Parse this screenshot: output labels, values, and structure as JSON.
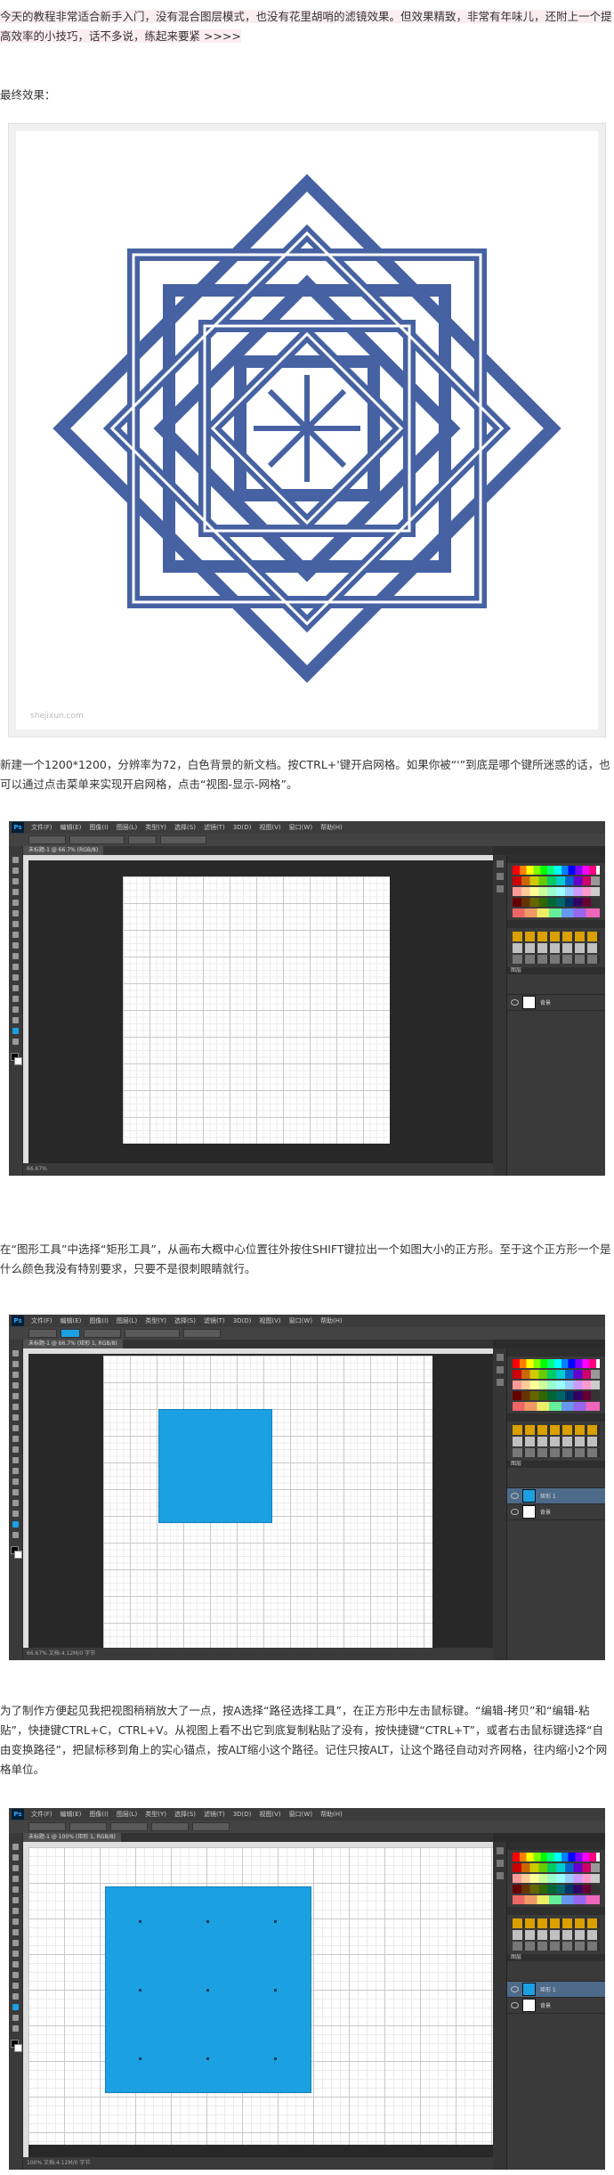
{
  "intro": {
    "paragraph": "今天的教程非常适合新手入门，没有混合图层模式，也没有花里胡哨的滤镜效果。但效果精致，非常有年味儿，还附上一个提高效率的小技巧，话不多说，练起来要紧 >>>>",
    "result_label": "最终效果："
  },
  "watermark": "shejixun.com",
  "colors": {
    "knot": "#4662a3",
    "shape_fill": "#1ba1e2",
    "page_bg": "#ffffff",
    "highlight": "#fbeef1"
  },
  "step1": {
    "paragraph": "新建一个1200*1200，分辨率为72，白色背景的新文档。按CTRL+'键开启网格。如果你被“'”到底是哪个键所迷惑的话，也可以通过点击菜单来实现开启网格，点击“视图-显示-网格”。"
  },
  "step2": {
    "paragraph": "在“图形工具”中选择“矩形工具”，从画布大概中心位置往外按住SHIFT键拉出一个如图大小的正方形。至于这个正方形一个是什么颜色我没有特别要求，只要不是很刺眼睛就行。"
  },
  "step3": {
    "paragraph": "为了制作方便起见我把视图稍稍放大了一点，按A选择“路径选择工具”，在正方形中左击鼠标键。“编辑-拷贝”和“编辑-粘贴”，快捷键CTRL+C，CTRL+V。从视图上看不出它到底复制粘贴了没有，按快捷键“CTRL+T”，或者右击鼠标键选择“自由变换路径”，把鼠标移到角上的实心锚点，按ALT缩小这个路径。记住只按ALT，让这个路径自动对齐网格，往内缩小2个网格单位。"
  },
  "photoshop": {
    "logo": "Ps",
    "menu": [
      "文件(F)",
      "编辑(E)",
      "图像(I)",
      "图层(L)",
      "类型(Y)",
      "选择(S)",
      "滤镜(T)",
      "3D(D)",
      "视图(V)",
      "窗口(W)",
      "帮助(H)"
    ],
    "tab1": "未标题-1 @ 66.7% (RGB/8)",
    "tab2": "未标题-1 @ 66.7% (矩形 1, RGB/8)",
    "tab3": "未标题-1 @ 100% (矩形 1, RGB/8)",
    "status1": "66.67%",
    "status2": "66.67%   文档:4.12M/0 字节",
    "status3": "100%   文档:4.12M/0 字节",
    "layers_title": "图层",
    "layer_background": "背景",
    "layer_shape": "矩形 1",
    "opacity": "100%"
  }
}
